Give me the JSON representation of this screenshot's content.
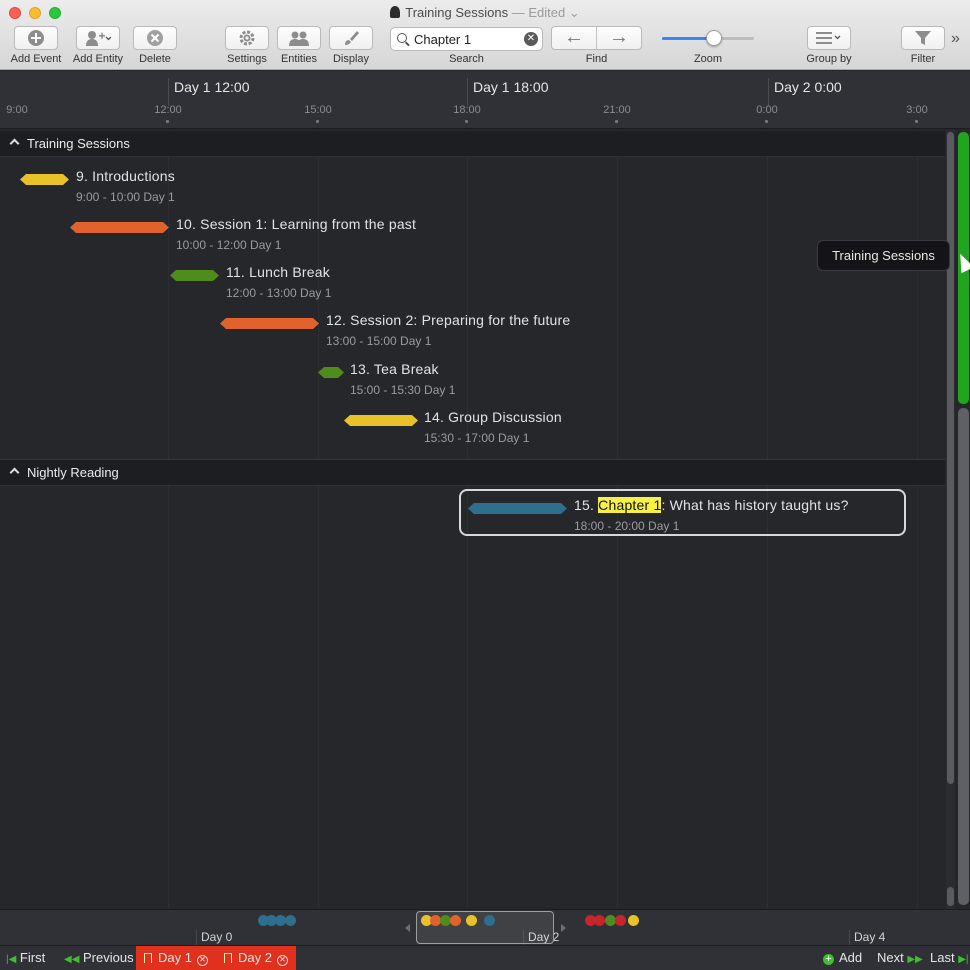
{
  "window": {
    "title": "Training Sessions",
    "edited_label": "— Edited"
  },
  "toolbar": {
    "add_event": "Add Event",
    "add_entity": "Add Entity",
    "delete": "Delete",
    "settings": "Settings",
    "entities": "Entities",
    "display": "Display",
    "search_value": "Chapter 1",
    "search_label": "Search",
    "find_label": "Find",
    "zoom_label": "Zoom",
    "zoom_level": 0.56,
    "group_by": "Group by",
    "filter": "Filter"
  },
  "ruler": {
    "major": [
      "Day 1 12:00",
      "Day 1 18:00",
      "Day 2 0:00"
    ],
    "minor": [
      "9:00",
      "12:00",
      "15:00",
      "18:00",
      "21:00",
      "0:00",
      "3:00"
    ]
  },
  "groups": [
    {
      "name": "Training Sessions",
      "events": [
        {
          "title": "9. Introductions",
          "time": "9:00 - 10:00 Day 1",
          "color": "#e8c228"
        },
        {
          "title": "10. Session 1: Learning from the past",
          "time": "10:00 - 12:00 Day 1",
          "color": "#e2622d"
        },
        {
          "title": "11. Lunch Break",
          "time": "12:00 - 13:00 Day 1",
          "color": "#4f8c1c"
        },
        {
          "title": "12. Session 2: Preparing for the future",
          "time": "13:00 - 15:00 Day 1",
          "color": "#e2622d"
        },
        {
          "title": "13. Tea Break",
          "time": "15:00 - 15:30 Day 1",
          "color": "#4f8c1c"
        },
        {
          "title": "14. Group Discussion",
          "time": "15:30 - 17:00 Day 1",
          "color": "#e8c228"
        }
      ]
    },
    {
      "name": "Nightly Reading",
      "events": [
        {
          "title_prefix": "15. ",
          "title_highlight": "Chapter 1",
          "title_suffix": ": What has history taught us?",
          "time": "18:00 - 20:00 Day 1",
          "color": "#2e6f8e"
        }
      ]
    }
  ],
  "tooltip": "Training Sessions",
  "overview": {
    "labels": [
      "Day 0",
      "Day 2",
      "Day 4"
    ]
  },
  "bottom": {
    "first": "First",
    "previous": "Previous",
    "bookmarks": [
      "Day 1",
      "Day 2"
    ],
    "add": "Add",
    "next": "Next",
    "last": "Last"
  },
  "colors": {
    "accent_green": "#21a521",
    "bookmark_red": "#e0301e",
    "search_highlight": "#f8f045"
  }
}
